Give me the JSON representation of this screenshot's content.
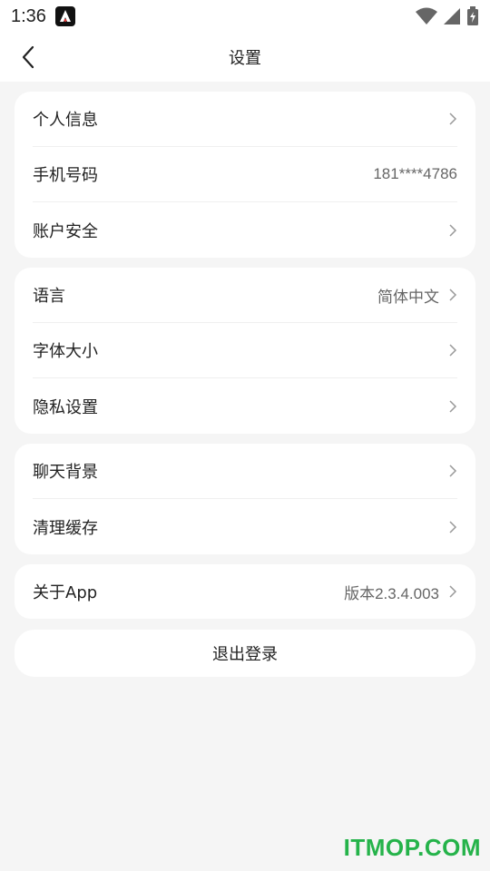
{
  "status_bar": {
    "time": "1:36"
  },
  "header": {
    "title": "设置"
  },
  "groups": [
    {
      "items": [
        {
          "label": "个人信息",
          "value": ""
        },
        {
          "label": "手机号码",
          "value": "181****4786"
        },
        {
          "label": "账户安全",
          "value": ""
        }
      ]
    },
    {
      "items": [
        {
          "label": "语言",
          "value": "简体中文"
        },
        {
          "label": "字体大小",
          "value": ""
        },
        {
          "label": "隐私设置",
          "value": ""
        }
      ]
    },
    {
      "items": [
        {
          "label": "聊天背景",
          "value": ""
        },
        {
          "label": "清理缓存",
          "value": ""
        }
      ]
    },
    {
      "items": [
        {
          "label": "关于App",
          "value": "版本2.3.4.003"
        }
      ]
    }
  ],
  "logout_label": "退出登录",
  "watermark": "ITMOP.COM"
}
